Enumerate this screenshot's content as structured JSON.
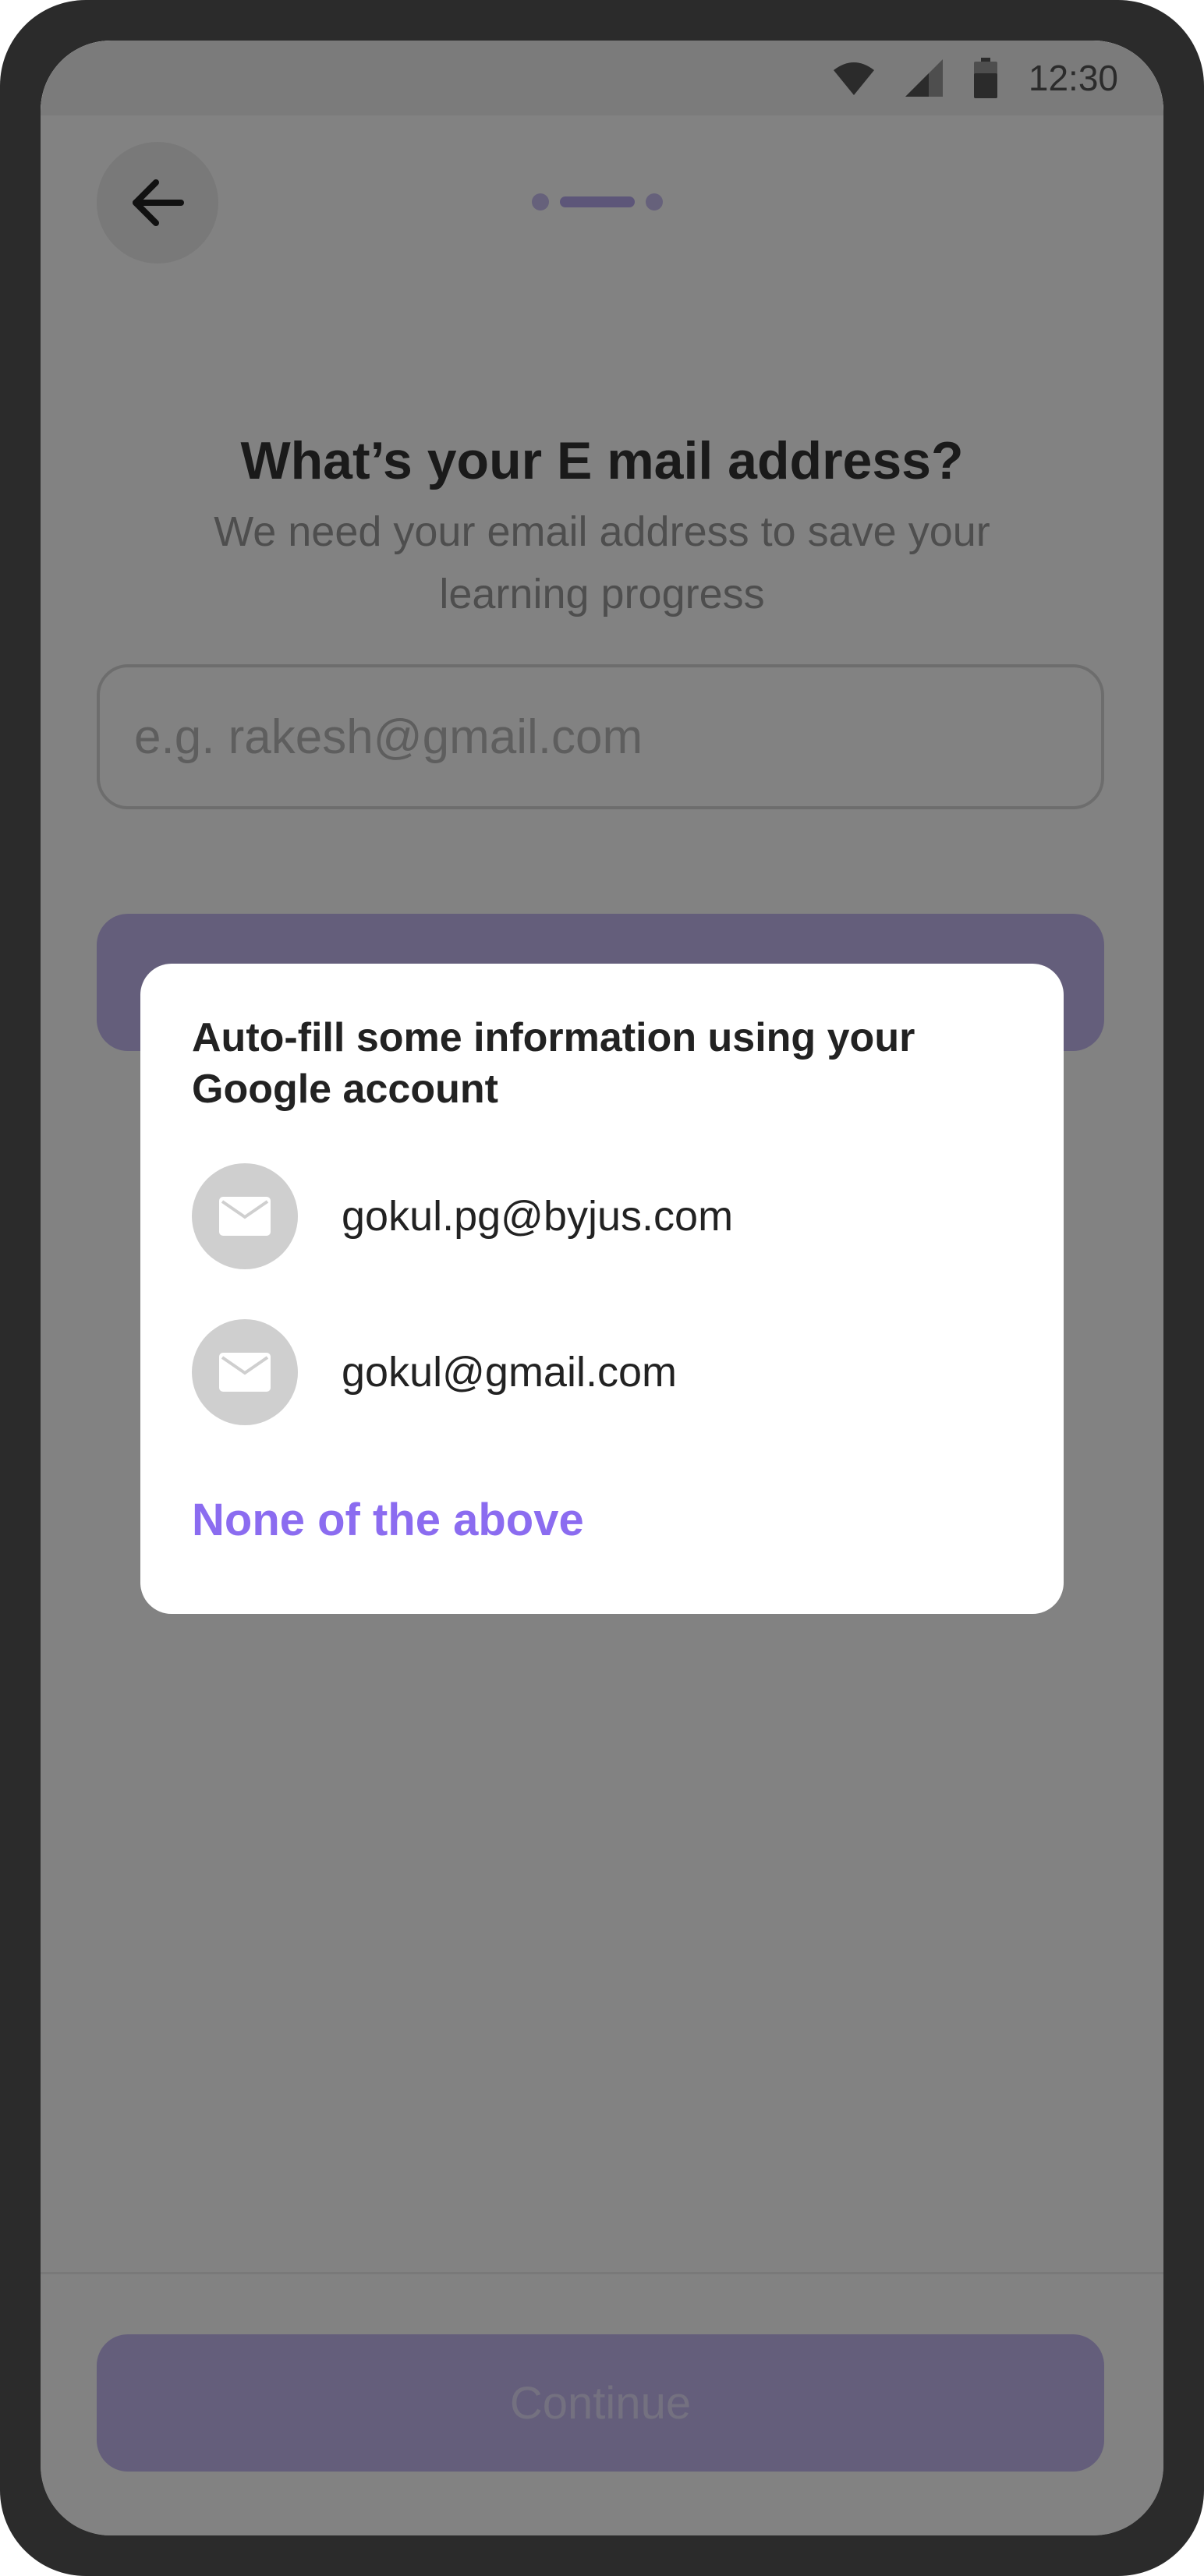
{
  "status_bar": {
    "time": "12:30",
    "icons": [
      "wifi-icon",
      "signal-icon",
      "battery-icon"
    ]
  },
  "header": {
    "back_icon": "arrow-left-icon",
    "progress": {
      "steps": 3,
      "current": 2
    }
  },
  "main": {
    "title": "What’s your E mail address?",
    "subtitle": "We need your email address to save your learning progress",
    "email_placeholder": "e.g. rakesh@gmail.com",
    "continue_label": "Continue"
  },
  "dialog": {
    "title": "Auto-fill some information using your Google account",
    "accounts": [
      {
        "email": "gokul.pg@byjus.com",
        "icon": "mail-icon"
      },
      {
        "email": "gokul@gmail.com",
        "icon": "mail-icon"
      }
    ],
    "none_label": "None of the above"
  },
  "colors": {
    "accent": "#8b6cf0",
    "button_bg": "#c5b9f2",
    "scrim": "#000000"
  }
}
